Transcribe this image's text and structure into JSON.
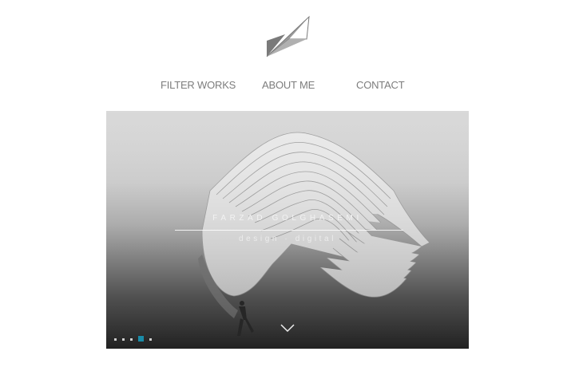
{
  "logo": {
    "icon": "triangle-logo-icon"
  },
  "nav": {
    "items": [
      {
        "label": "FILTER WORKS"
      },
      {
        "label": "ABOUT ME"
      },
      {
        "label": "CONTACT"
      }
    ]
  },
  "hero": {
    "title": "FARZAD GOLGHASEMI",
    "subtitle": "design · digital",
    "scroll_icon": "chevron-down-icon",
    "slides_total": 5,
    "active_slide": 4
  },
  "colors": {
    "accent": "#1a8ca8",
    "nav_text": "#7d7d7d",
    "logo_gray": "#8f8f8f"
  }
}
